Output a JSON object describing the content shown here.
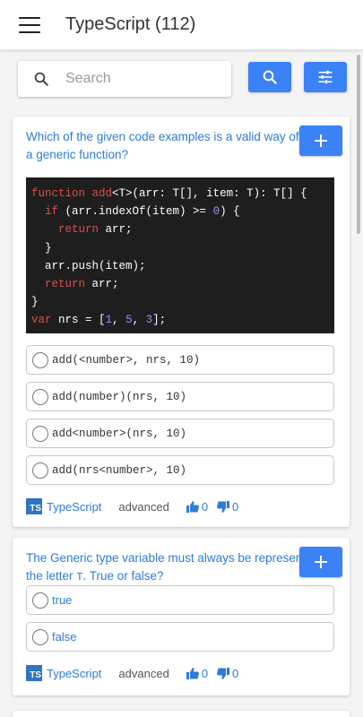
{
  "app": {
    "title": "TypeScript (112)"
  },
  "search": {
    "placeholder": "Search",
    "value": ""
  },
  "questions": [
    {
      "text": "Which of the given code examples is a valid way of calling a generic function?",
      "code_lines": [
        "function add<T>(arr: T[], item: T): T[] {",
        "  if (arr.indexOf(item) >= 0) {",
        "    return arr;",
        "  }",
        "  arr.push(item);",
        "  return arr;",
        "}",
        "var nrs = [1, 5, 3];"
      ],
      "options": [
        "add(<number>, nrs, 10)",
        "add(number)(nrs, 10)",
        "add<number>(nrs, 10)",
        "add(nrs<number>, 10)"
      ],
      "tag": "TypeScript",
      "level": "advanced",
      "upvotes": "0",
      "downvotes": "0"
    },
    {
      "text_before": "The Generic type variable must always be represented by the letter ",
      "text_code": "T",
      "text_after": ". True or false?",
      "options": [
        "true",
        "false"
      ],
      "tag": "TypeScript",
      "level": "advanced",
      "upvotes": "0",
      "downvotes": "0"
    }
  ],
  "logo_text": "TS",
  "colors": {
    "accent": "#3b82f6",
    "link": "#2f7bd8",
    "code_bg": "#1e1e1e",
    "keyword": "#d8504f",
    "number": "#a887ee"
  },
  "icons": [
    "menu-icon",
    "search-icon",
    "filter-icon",
    "plus-icon",
    "thumbs-up-icon",
    "thumbs-down-icon",
    "typescript-logo-icon"
  ]
}
